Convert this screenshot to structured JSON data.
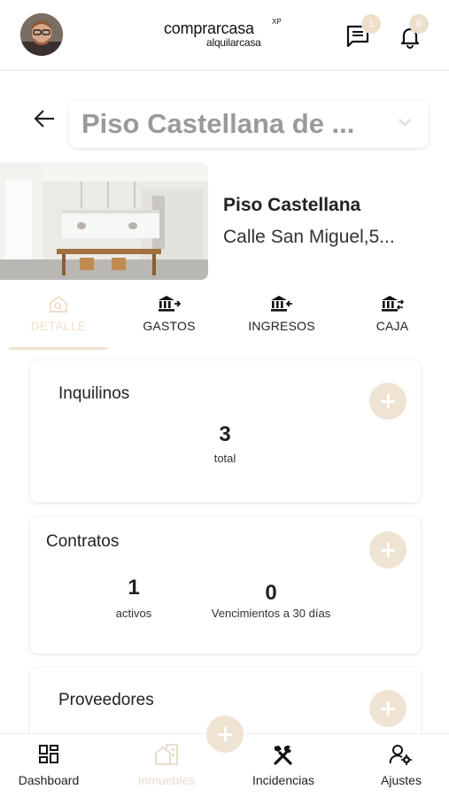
{
  "header": {
    "brand_main": "comprarcasa",
    "brand_xp": "XP",
    "brand_sub": "alquilarcasa",
    "messages_badge": "1",
    "notifications_badge": "0",
    "icons": [
      "avatar",
      "messages-icon",
      "bell-icon"
    ]
  },
  "selector": {
    "value": "Piso Castellana de ..."
  },
  "property": {
    "name": "Piso Castellana",
    "address": "Calle San Miguel,5..."
  },
  "tabs": [
    {
      "label": "DETALLE",
      "icon": "house-search-icon",
      "active": true
    },
    {
      "label": "GASTOS",
      "icon": "bank-out-icon",
      "active": false
    },
    {
      "label": "INGRESOS",
      "icon": "bank-in-icon",
      "active": false
    },
    {
      "label": "CAJA",
      "icon": "bank-exchange-icon",
      "active": false
    }
  ],
  "cards": {
    "inquilinos": {
      "title": "Inquilinos",
      "count": "3",
      "count_label": "total"
    },
    "contratos": {
      "title": "Contratos",
      "active": "1",
      "active_label": "activos",
      "expiring": "0",
      "expiring_label": "Vencimientos a 30 días"
    },
    "proveedores": {
      "title": "Proveedores"
    }
  },
  "bottom_nav": [
    {
      "label": "Dashboard",
      "icon": "dashboard-icon"
    },
    {
      "label": "Inmuebles",
      "icon": "building-icon"
    },
    {
      "label": "Incidencias",
      "icon": "tools-icon"
    },
    {
      "label": "Ajustes",
      "icon": "user-settings-icon"
    }
  ],
  "colors": {
    "accent": "#efe3d4",
    "text": "#222222",
    "muted": "#9a9a9a"
  }
}
